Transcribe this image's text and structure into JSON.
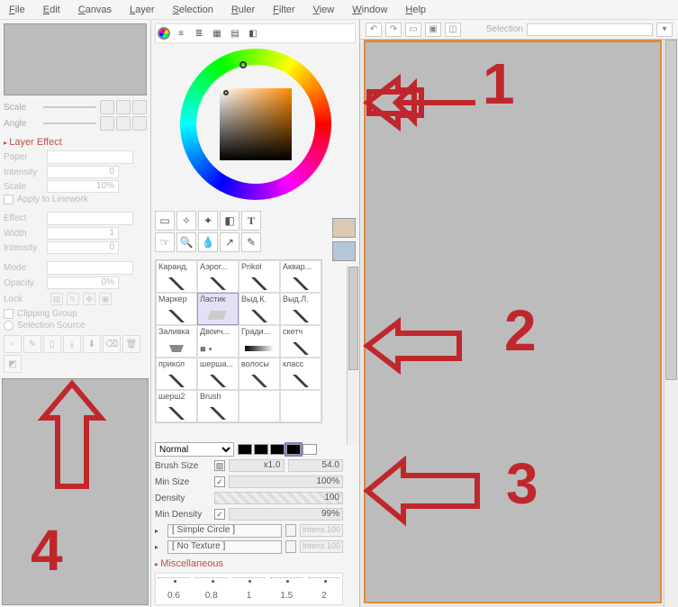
{
  "menu": [
    "File",
    "Edit",
    "Canvas",
    "Layer",
    "Selection",
    "Ruler",
    "Filter",
    "View",
    "Window",
    "Help"
  ],
  "left": {
    "scale_label": "Scale",
    "angle_label": "Angle",
    "layer_effect_header": "Layer Effect",
    "paper_label": "Paper",
    "intensity_label": "Intensity",
    "intensity_val": "0",
    "scale2_label": "Scale",
    "scale2_val": "10%",
    "apply_linework": "Apply to Linework",
    "effect_label": "Effect",
    "width_label": "Width",
    "width_val": "1",
    "intensity2_label": "Intensity",
    "intensity2_val": "0",
    "mode_label": "Mode",
    "opacity_label": "Opacity",
    "opacity_val": "0%",
    "lock_label": "Lock",
    "clipping_group": "Clipping Group",
    "selection_source": "Selection Source"
  },
  "tools": {
    "row1": [
      "▭",
      "✧",
      "✦",
      "◧",
      "T"
    ],
    "row2": [
      "☞",
      "🔍",
      "💧",
      "↗",
      "✎"
    ]
  },
  "brushes": [
    {
      "name": "Каранд.",
      "style": "pencil"
    },
    {
      "name": "Аэрог...",
      "style": "pencil"
    },
    {
      "name": "Prikol",
      "style": "pencil"
    },
    {
      "name": "Аквар...",
      "style": "pencil"
    },
    {
      "name": "Маркер",
      "style": "pencil"
    },
    {
      "name": "Ластик",
      "style": "erase",
      "sel": true
    },
    {
      "name": "Выд.К.",
      "style": "pencil"
    },
    {
      "name": "Выд.Л.",
      "style": "pencil"
    },
    {
      "name": "Заливка",
      "style": "bucket"
    },
    {
      "name": "Двоич...",
      "style": "binary"
    },
    {
      "name": "Гради...",
      "style": "grad"
    },
    {
      "name": "скетч",
      "style": "pencil"
    },
    {
      "name": "прикол",
      "style": "pencil"
    },
    {
      "name": "шерша...",
      "style": "pencil"
    },
    {
      "name": "волосы",
      "style": "pencil"
    },
    {
      "name": "класс",
      "style": "pencil"
    },
    {
      "name": "шерш2",
      "style": "pencil"
    },
    {
      "name": "Brush",
      "style": "pencil"
    }
  ],
  "settings": {
    "blend": "Normal",
    "brush_size_lbl": "Brush Size",
    "brush_size_mult": "x1.0",
    "brush_size_val": "54.0",
    "min_size_lbl": "Min Size",
    "min_size_val": "100%",
    "density_lbl": "Density",
    "density_val": "100",
    "min_density_lbl": "Min Density",
    "min_density_val": "99%",
    "shape_combo": "[ Simple Circle ]",
    "tex_combo": "[ No Texture ]",
    "intensity_ghost": "Intens.100",
    "misc_header": "Miscellaneous",
    "spacing": [
      "0.6",
      "0.8",
      "1",
      "1.5",
      "2"
    ]
  },
  "canvas_toolbar": {
    "selection_label": "Selection"
  },
  "anno": {
    "n1": "1",
    "n2": "2",
    "n3": "3",
    "n4": "4"
  }
}
